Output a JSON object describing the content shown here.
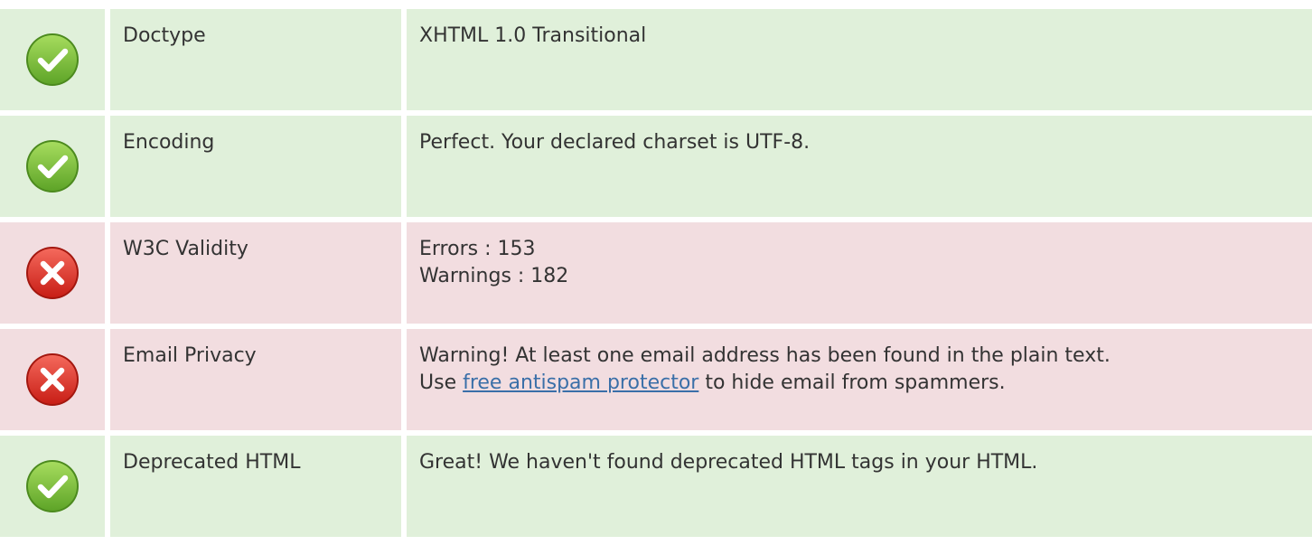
{
  "colors": {
    "pass_row_bg": "#e0f0da",
    "fail_row_bg": "#f2dde0",
    "pass_icon": "#7ac142",
    "fail_icon": "#e0312b",
    "link": "#3a6fa8"
  },
  "rows": [
    {
      "status": "pass",
      "icon": "check-circle-icon",
      "label": "Doctype",
      "lines": [
        "XHTML 1.0 Transitional"
      ]
    },
    {
      "status": "pass",
      "icon": "check-circle-icon",
      "label": "Encoding",
      "lines": [
        "Perfect. Your declared charset is UTF-8."
      ]
    },
    {
      "status": "fail",
      "icon": "x-circle-icon",
      "label": "W3C Validity",
      "lines": [
        "Errors : 153",
        "Warnings : 182"
      ]
    },
    {
      "status": "fail",
      "icon": "x-circle-icon",
      "label": "Email Privacy",
      "line1": "Warning! At least one email address has been found in the plain text.",
      "line2_prefix": "Use ",
      "line2_link": "free antispam protector",
      "line2_suffix": " to hide email from spammers."
    },
    {
      "status": "pass",
      "icon": "check-circle-icon",
      "label": "Deprecated HTML",
      "lines": [
        "Great! We haven't found deprecated HTML tags in your HTML."
      ]
    }
  ]
}
